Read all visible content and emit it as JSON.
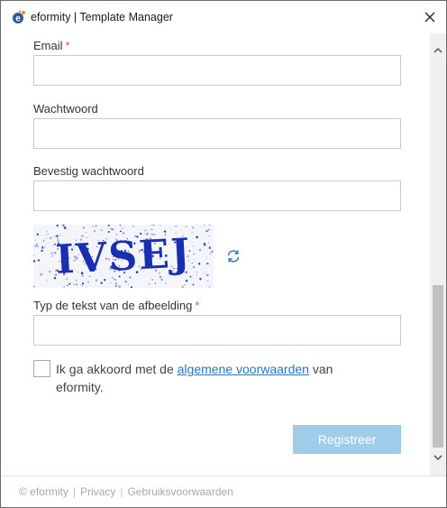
{
  "window": {
    "title": "eformity | Template Manager"
  },
  "form": {
    "email_label": "Email",
    "email_value": "",
    "password_label": "Wachtwoord",
    "password_value": "",
    "confirm_label": "Bevestig wachtwoord",
    "confirm_value": "",
    "captcha_text": "IVSEJ",
    "captcha_input_label": "Typ de tekst van de afbeelding",
    "captcha_input_value": "",
    "required_marker": "*",
    "agree_prefix": "Ik ga akkoord met de ",
    "agree_link": "algemene voorwaarden",
    "agree_suffix": " van eformity.",
    "agree_checked": false,
    "register_label": "Registreer"
  },
  "footer": {
    "copyright": "© eformity",
    "privacy": "Privacy",
    "terms": "Gebruiksvoorwaarden",
    "separator": "|"
  },
  "colors": {
    "accent_link": "#2a74c2",
    "button_disabled": "#9fcce8",
    "required": "#d9534f",
    "captcha_ink": "#1a2fb0",
    "logo_blue": "#2d5a9a",
    "logo_orange": "#f08a24"
  }
}
